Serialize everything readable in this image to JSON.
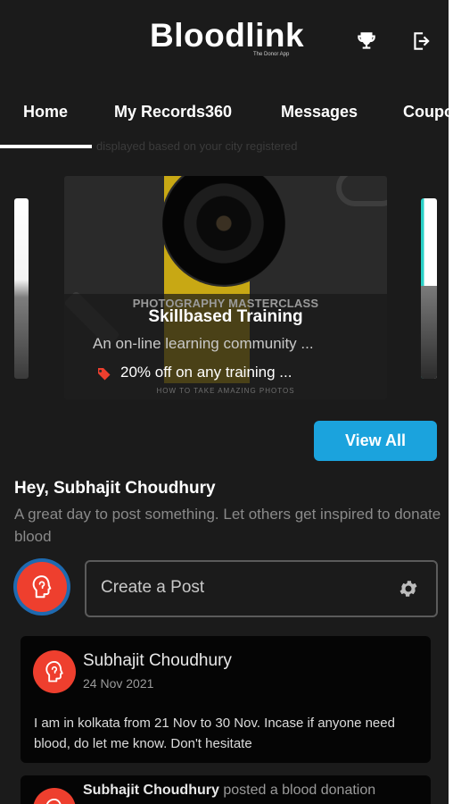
{
  "header": {
    "logo_text": "Bloodlink",
    "logo_subtitle": "The Donor App",
    "trophy_icon": "trophy-icon",
    "logout_icon": "logout-icon"
  },
  "tabs": [
    {
      "label": "Home",
      "active": true
    },
    {
      "label": "My Records360",
      "active": false
    },
    {
      "label": "Messages",
      "active": false
    },
    {
      "label": "Coupo",
      "active": false
    }
  ],
  "tab_hint": "displayed based on your city registered",
  "promo": {
    "image_caption_top": "PHOTOGRAPHY MASTERCLASS",
    "title": "Skillbased Training",
    "description": "An on-line learning community ...",
    "offer": "20% off on any training ...",
    "image_caption_bottom": "HOW TO TAKE AMAZING PHOTOS"
  },
  "view_all_label": "View All",
  "greeting": {
    "title": "Hey, Subhajit Choudhury",
    "subtitle": "A great day to post something. Let others get inspired to donate blood"
  },
  "create_post": {
    "label": "Create a Post",
    "settings_icon": "gear-icon"
  },
  "posts": [
    {
      "author": "Subhajit Choudhury",
      "date": "24 Nov 2021",
      "body": "I am in kolkata from 21 Nov to 30 Nov. Incase if anyone need blood, do let me know. Don't hesitate"
    },
    {
      "author": "Subhajit Choudhury",
      "action": "posted a blood donation"
    }
  ],
  "colors": {
    "background": "#1b1b1b",
    "accent_blue": "#1ba3dd",
    "avatar_red": "#ee3f2e",
    "card": "#050505"
  }
}
